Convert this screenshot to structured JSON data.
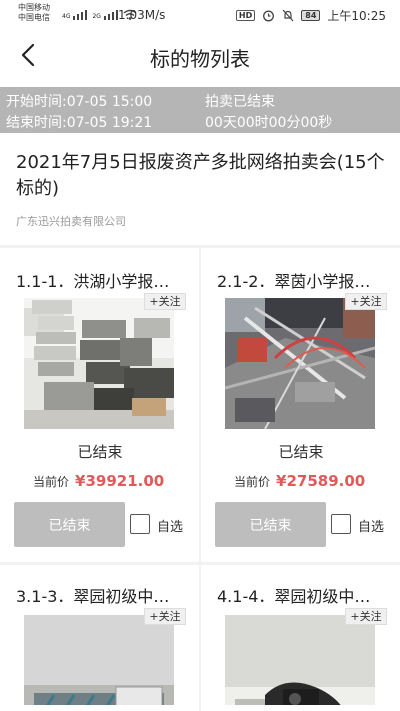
{
  "status_bar": {
    "carrier1": "中国移动",
    "carrier2": "中国电信",
    "net1": "4G",
    "net2": "2G",
    "speed": "1.03M/s",
    "hd": "HD",
    "battery": "84",
    "time": "上午10:25"
  },
  "nav": {
    "title": "标的物列表"
  },
  "info": {
    "start_time": "开始时间:07-05 15:00",
    "end_time": "结束时间:07-05 19:21",
    "status": "拍卖已结束",
    "countdown": "00天00时00分00秒"
  },
  "auction": {
    "title": "2021年7月5日报废资产多批网络拍卖会(15个标的)",
    "company": "广东迅兴拍卖有限公司"
  },
  "lots": [
    {
      "title": "1.1-1．洪湖小学报…",
      "follow": "+关注",
      "status": "已结束",
      "price_label": "当前价",
      "price": "¥39921.00",
      "button": "已结束",
      "fav": "自选"
    },
    {
      "title": "2.1-2．翠茵小学报…",
      "follow": "+关注",
      "status": "已结束",
      "price_label": "当前价",
      "price": "¥27589.00",
      "button": "已结束",
      "fav": "自选"
    },
    {
      "title": "3.1-3．翠园初级中…",
      "follow": "+关注"
    },
    {
      "title": "4.1-4．翠园初级中…",
      "follow": "+关注"
    }
  ]
}
